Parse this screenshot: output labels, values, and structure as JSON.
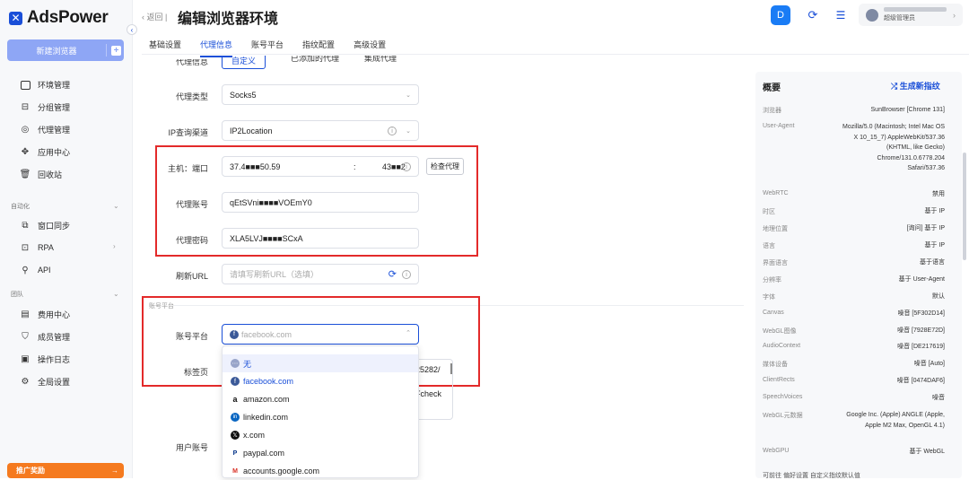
{
  "app": {
    "name": "AdsPower",
    "new_browser": "新建浏览器",
    "promo": "推广奖励"
  },
  "nav": {
    "env": "环境管理",
    "group": "分组管理",
    "proxy": "代理管理",
    "apps": "应用中心",
    "trash": "回收站",
    "sect_auto": "自动化",
    "sync": "窗口同步",
    "rpa": "RPA",
    "api": "API",
    "sect_team": "团队",
    "billing": "费用中心",
    "members": "成员管理",
    "logs": "操作日志",
    "settings": "全局设置"
  },
  "header": {
    "back": "返回",
    "title": "编辑浏览器环境",
    "user_name": "超级管理员"
  },
  "tabs": [
    "基础设置",
    "代理信息",
    "账号平台",
    "指纹配置",
    "高级设置"
  ],
  "proxy_tabs": [
    "代理信息",
    "自定义",
    "已添加的代理",
    "集成代理"
  ],
  "form": {
    "proxy_type_label": "代理类型",
    "proxy_type": "Socks5",
    "ip_channel_label": "IP查询渠道",
    "ip_channel": "IP2Location",
    "host_label": "主机：端口",
    "host": "37.4■■■50.59",
    "port_sep": ":",
    "port": "43■■2",
    "check_btn": "检查代理",
    "account_label": "代理账号",
    "account": "qEtSVni■■■■VOEmY0",
    "password_label": "代理密码",
    "password": "XLA5LVJ■■■■SCxA",
    "refresh_label": "刷新URL",
    "refresh_placeholder": "请填写刷新URL（选填）",
    "section_account": "账号平台",
    "platform_label": "账号平台",
    "platform_placeholder": "facebook.com",
    "tabs_label": "标签页",
    "tabs_value_1": "25282/",
    "tabs_value_2": "Fcheck",
    "user_account_label": "用户账号"
  },
  "dropdown": [
    "无",
    "facebook.com",
    "amazon.com",
    "linkedin.com",
    "x.com",
    "paypal.com",
    "accounts.google.com"
  ],
  "panel": {
    "title": "概要",
    "generate": "生成新指纹",
    "rows": [
      {
        "k": "浏览器",
        "v": "SunBrowser [Chrome 131]"
      },
      {
        "k": "User-Agent",
        "v": "Mozilla/5.0 (Macintosh; Intel Mac OS X 10_15_7) AppleWebKit/537.36 (KHTML, like Gecko) Chrome/131.0.6778.204 Safari/537.36"
      },
      {
        "k": "WebRTC",
        "v": "禁用"
      },
      {
        "k": "时区",
        "v": "基于 IP"
      },
      {
        "k": "地理位置",
        "v": "[询问] 基于 IP"
      },
      {
        "k": "语言",
        "v": "基于 IP"
      },
      {
        "k": "界面语言",
        "v": "基于语言"
      },
      {
        "k": "分辨率",
        "v": "基于 User-Agent"
      },
      {
        "k": "字体",
        "v": "默认"
      },
      {
        "k": "Canvas",
        "v": "噪音 [5F302D14]"
      },
      {
        "k": "WebGL图像",
        "v": "噪音 [7928E72D]"
      },
      {
        "k": "AudioContext",
        "v": "噪音 [DE217619]"
      },
      {
        "k": "媒体设备",
        "v": "噪音 [Auto]"
      },
      {
        "k": "ClientRects",
        "v": "噪音 [0474DAF6]"
      },
      {
        "k": "SpeechVoices",
        "v": "噪音"
      },
      {
        "k": "WebGL元数据",
        "v": "Google Inc. (Apple) ANGLE (Apple, Apple M2 Max, OpenGL 4.1)"
      },
      {
        "k": "WebGPU",
        "v": "基于 WebGL"
      }
    ],
    "footer": "可前往 偏好设置 自定义指纹默认值"
  },
  "colors": {
    "accent": "#1a4fd8",
    "highlight": "#e32a2a",
    "promo": "#f57a1f"
  }
}
